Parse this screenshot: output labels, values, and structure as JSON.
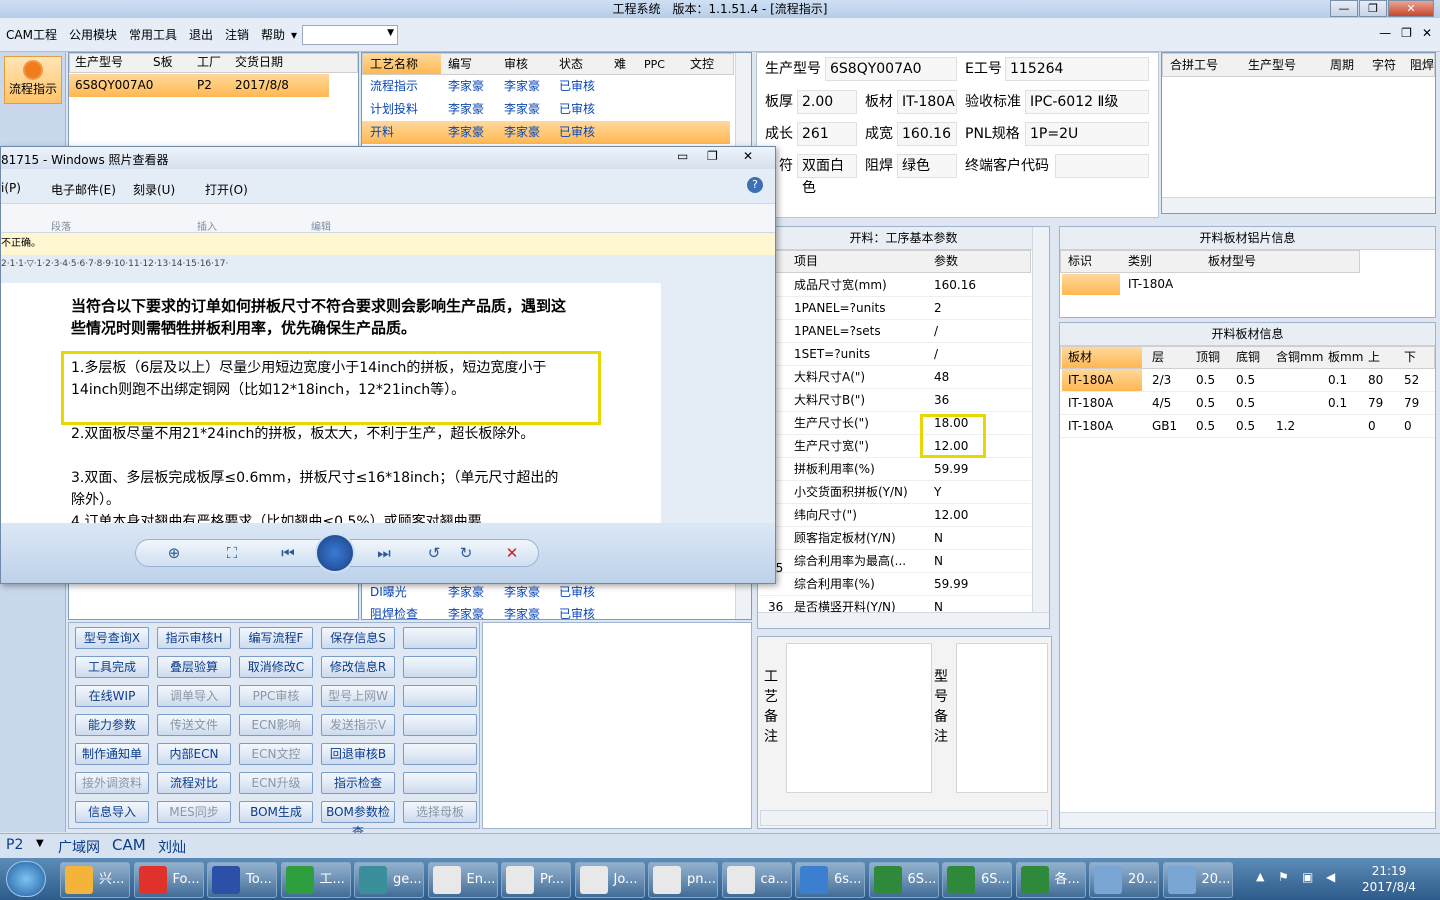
{
  "window": {
    "title": "工程系统　版本：1.1.51.4 - [流程指示]",
    "controls": [
      "—",
      "❐",
      "✕"
    ]
  },
  "menu": [
    "CAM工程",
    "公用模块",
    "常用工具",
    "退出",
    "注销",
    "帮助"
  ],
  "menu_right_controls": [
    "—",
    "❐",
    "✕"
  ],
  "side_button": "流程指示",
  "order_table": {
    "headers": [
      "生产型号",
      "S板",
      "工厂",
      "交货日期"
    ],
    "row": [
      "6S8QY007A0",
      "",
      "P2",
      "2017/8/8"
    ]
  },
  "process_table": {
    "headers": [
      "工艺名称",
      "编写",
      "审核",
      "状态",
      "难",
      "PPC",
      "文控"
    ],
    "rows": [
      [
        "流程指示",
        "李家豪",
        "李家豪",
        "已审核"
      ],
      [
        "计划投料",
        "李家豪",
        "李家豪",
        "已审核"
      ],
      [
        "开料",
        "李家豪",
        "李家豪",
        "已审核"
      ]
    ],
    "bottom_rows": [
      [
        "DI曝光",
        "李家豪",
        "李家豪",
        "已审核"
      ],
      [
        "阻焊检查",
        "李家豪",
        "李家豪",
        "已审核"
      ]
    ]
  },
  "info": {
    "prod_model_label": "生产型号",
    "prod_model": "6S8QY007A0",
    "e_job_label": "E工号",
    "e_job": "115264",
    "thickness_label": "板厚",
    "thickness": "2.00",
    "material_label": "板材",
    "material": "IT-180A",
    "accept_label": "验收标准",
    "accept": "IPC-6012 Ⅱ级",
    "len_label": "成长",
    "len": "261",
    "wid_label": "成宽",
    "wid": "160.16",
    "pnl_label": "PNL规格",
    "pnl": "1P=2U",
    "char_label": "符",
    "char_value": "双面白色",
    "mask_label": "阻焊",
    "mask": "绿色",
    "customer_label": "终端客户代码",
    "customer": ""
  },
  "merge_table": {
    "headers": [
      "合拼工号",
      "生产型号",
      "周期",
      "字符",
      "阻焊"
    ]
  },
  "params_panel": {
    "title": "开料：工序基本参数",
    "headers": [
      "项目",
      "参数"
    ],
    "rows": [
      [
        "成品尺寸宽(mm)",
        "160.16"
      ],
      [
        "1PANEL=?units",
        "2"
      ],
      [
        "1PANEL=?sets",
        "/"
      ],
      [
        "1SET=?units",
        "/"
      ],
      [
        "大料尺寸A(\")",
        "48"
      ],
      [
        "大料尺寸B(\")",
        "36"
      ],
      [
        "生产尺寸长(\")",
        "18.00"
      ],
      [
        "生产尺寸宽(\")",
        "12.00"
      ],
      [
        "拼板利用率(%)",
        "59.99"
      ],
      [
        "小交货面积拼板(Y/N)",
        "Y"
      ],
      [
        "纬向尺寸(\")",
        "12.00"
      ],
      [
        "顾客指定板材(Y/N)",
        "N"
      ],
      [
        "综合利用率为最高(...",
        "N"
      ],
      [
        "综合利用率(%)",
        "59.99"
      ],
      [
        "是否横竖开料(Y/N)",
        "N"
      ]
    ],
    "row_numbers": [
      "35",
      "36"
    ]
  },
  "alu_panel": {
    "title": "开料板材铝片信息",
    "headers": [
      "标识",
      "类别",
      "板材型号"
    ],
    "row": [
      "",
      "IT-180A",
      ""
    ]
  },
  "sheet_panel": {
    "title": "开料板材信息",
    "headers": [
      "板材",
      "层",
      "顶铜",
      "底铜",
      "含铜mm",
      "板mm",
      "上",
      "下"
    ],
    "rows": [
      [
        "IT-180A",
        "2/3",
        "0.5",
        "0.5",
        "",
        "0.1",
        "80",
        "52"
      ],
      [
        "IT-180A",
        "4/5",
        "0.5",
        "0.5",
        "",
        "0.1",
        "79",
        "79"
      ],
      [
        "IT-180A",
        "GB1",
        "0.5",
        "0.5",
        "1.2",
        "",
        "0",
        "0"
      ]
    ]
  },
  "notes": {
    "process_label": "工艺备注",
    "model_label": "型号备注"
  },
  "buttons": [
    [
      "型号查询X",
      "指示审核H",
      "编写流程F",
      "保存信息S",
      ""
    ],
    [
      "工具完成",
      "叠层验算",
      "取消修改C",
      "修改信息R",
      ""
    ],
    [
      "在线WIP",
      "调单导入",
      "PPC审核",
      "型号上网W",
      ""
    ],
    [
      "能力参数",
      "传送文件",
      "ECN影响",
      "发送指示V",
      ""
    ],
    [
      "制作通知单",
      "内部ECN",
      "ECN文控",
      "回退审核B",
      ""
    ],
    [
      "接外调资料",
      "流程对比",
      "ECN升级",
      "指示检查",
      ""
    ],
    [
      "信息导入",
      "MES同步",
      "BOM生成",
      "BOM参数检查",
      "选择母板"
    ]
  ],
  "disabled_buttons": [
    "调单导入",
    "PPC审核",
    "型号上网W",
    "传送文件",
    "ECN影响",
    "发送指示V",
    "ECN文控",
    "接外调资料",
    "ECN升级",
    "MES同步",
    "选择母板"
  ],
  "status_bar": [
    "P2",
    "广域网",
    "CAM",
    "刘灿"
  ],
  "viewer": {
    "title": "81715 - Windows 照片查看器",
    "menu": [
      "i(P)",
      "电子邮件(E)",
      "刻录(U)",
      "打开(O)"
    ],
    "ribbon_groups": [
      "段落",
      "插入",
      "编辑"
    ],
    "warning": "不正确。",
    "ruler": "2·1·1·▽·1·2·3·4·5·6·7·8·9·10·11·12·13·14·15·16·17·",
    "heading": "当符合以下要求的订单如何拼板尺寸不符合要求则会影响生产品质，遇到这些情况时则需牺牲拼板利用率，优先确保生产品质。",
    "items": [
      "1.多层板（6层及以上）尽量少用短边宽度小于14inch的拼板，短边宽度小于14inch则跑不出绑定铜网（比如12*18inch，12*21inch等）。",
      "2.双面板尽量不用21*24inch的拼板，板太大，不利于生产，超长板除外。",
      "3.双面、多层板完成板厚≤0.6mm，拼板尺寸≤16*18inch；（单元尺寸超出的除外）。",
      "4.订单本身对翘曲有严格要求（比如翘曲≤0.5%）或顾客对翘曲要"
    ]
  },
  "taskbar": {
    "items": [
      "兴...",
      "Fo...",
      "To...",
      "工...",
      "ge...",
      "En...",
      "Pr...",
      "Jo...",
      "pn...",
      "ca...",
      "6s...",
      "6S...",
      "6S...",
      "各...",
      "20...",
      "20..."
    ],
    "time": "21:19",
    "date": "2017/8/4"
  },
  "colors": {
    "selected": "#ffc36a",
    "highlight_box": "#e6d800",
    "link": "#0a46b5"
  }
}
